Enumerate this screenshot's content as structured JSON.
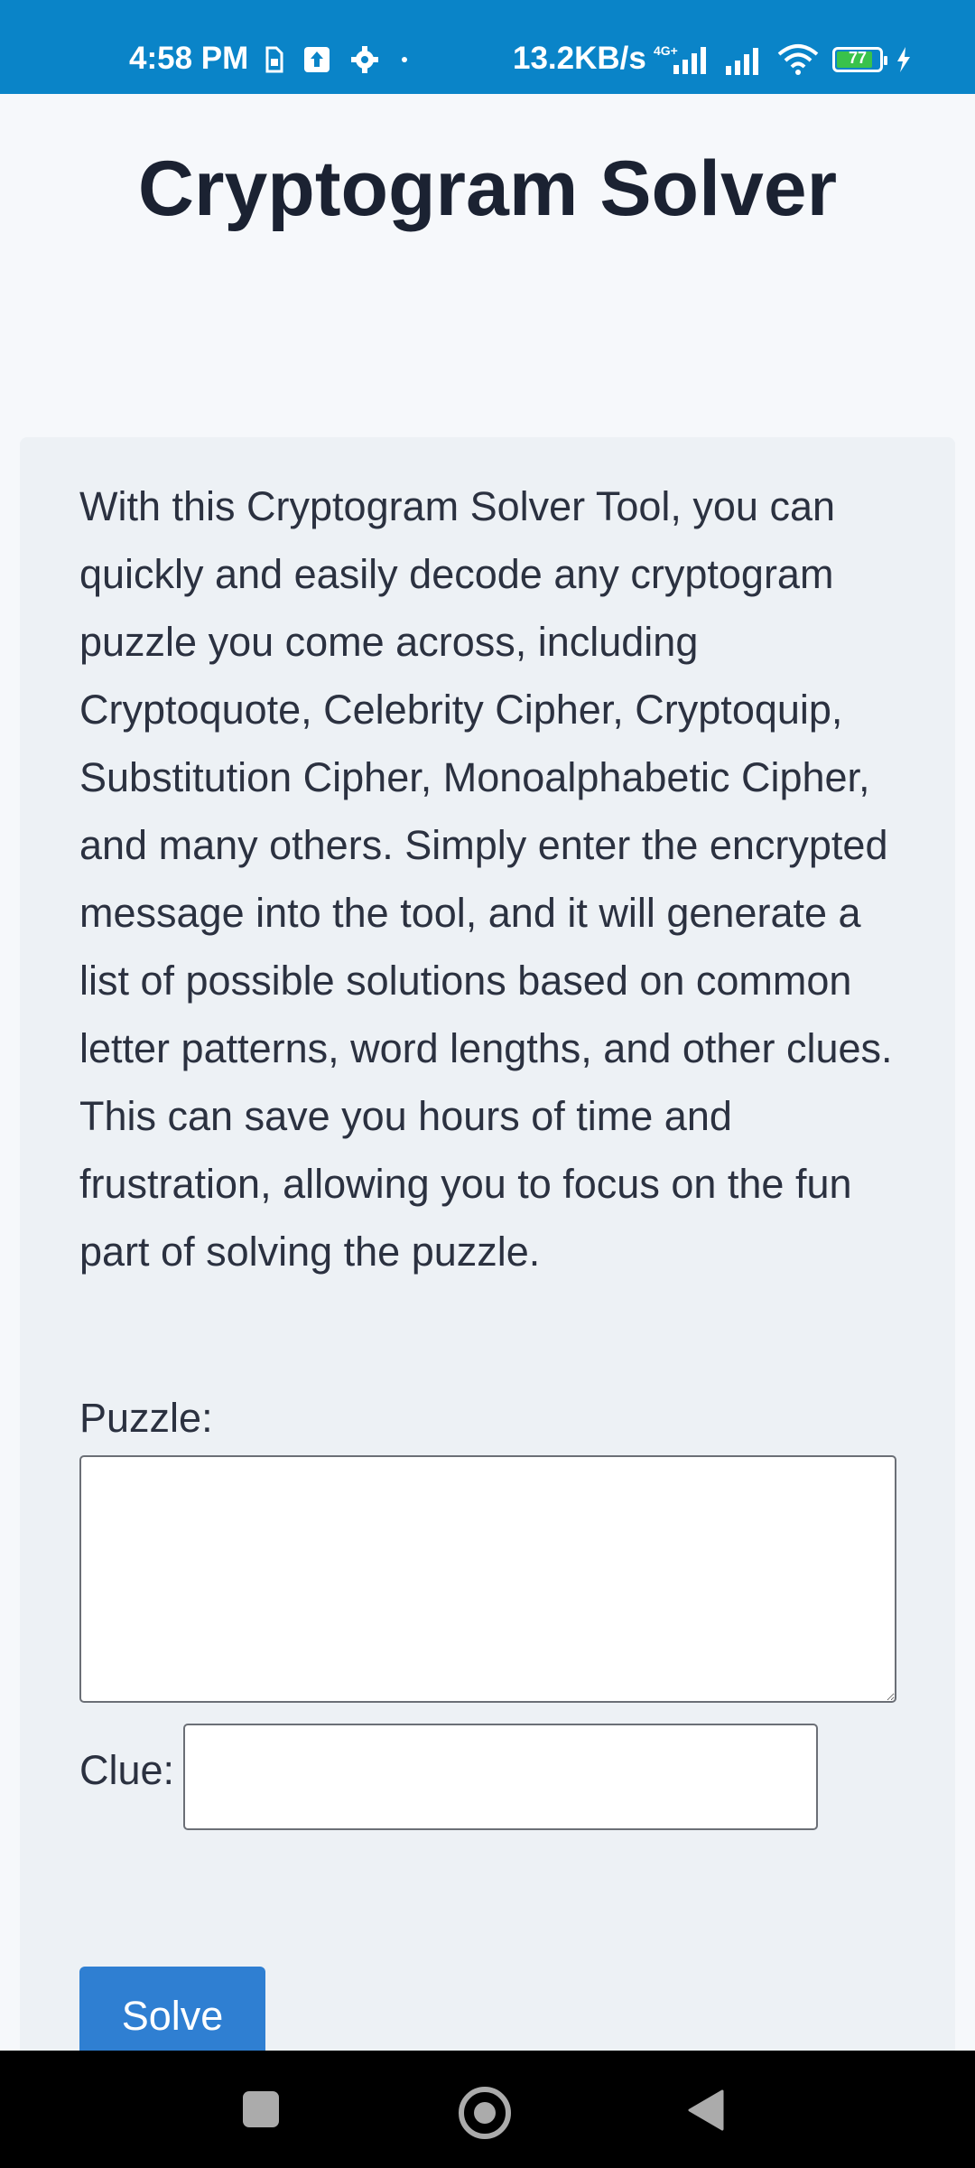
{
  "status_bar": {
    "time": "4:58 PM",
    "network_speed": "13.2KB/s",
    "network_type": "4G+",
    "battery_level": "77",
    "icons_left": [
      "sim-icon",
      "upload-icon",
      "settings-icon",
      "dot-icon"
    ],
    "icons_right": [
      "signal-4g-icon",
      "signal-icon",
      "wifi-icon",
      "battery-icon",
      "charging-icon"
    ]
  },
  "page": {
    "title": "Cryptogram Solver",
    "description": "With this Cryptogram Solver Tool, you can quickly and easily decode any cryptogram puzzle you come across, including Cryptoquote, Celebrity Cipher, Cryptoquip, Substitution Cipher, Monoalphabetic Cipher, and many others. Simply enter the encrypted message into the tool, and it will generate a list of possible solutions based on common letter patterns, word lengths, and other clues. This can save you hours of time and frustration, allowing you to focus on the fun part of solving the puzzle."
  },
  "form": {
    "puzzle_label": "Puzzle:",
    "puzzle_value": "",
    "clue_label": "Clue:",
    "clue_value": "",
    "solve_label": "Solve"
  },
  "nav_bar": {
    "icons": [
      "recents-icon",
      "home-icon",
      "back-icon"
    ]
  },
  "colors": {
    "status_bar": "#0a84c8",
    "page_bg": "#f6f8fb",
    "card_bg": "#edf1f5",
    "solve_button": "#2f7fd2",
    "battery_fill": "#39c24b"
  }
}
